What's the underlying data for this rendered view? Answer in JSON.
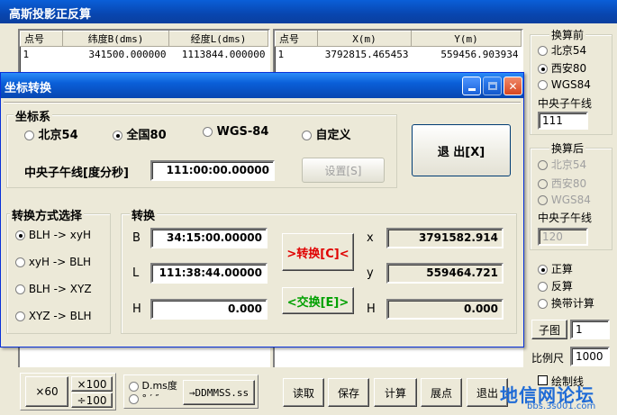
{
  "outer": {
    "title": "高斯投影正反算",
    "left_table": {
      "headers": [
        "点号",
        "纬度B(dms)",
        "经度L(dms)"
      ],
      "rows": [
        [
          "1",
          "341500.000000",
          "1113844.000000"
        ]
      ]
    },
    "right_table": {
      "headers": [
        "点号",
        "X(m)",
        "Y(m)"
      ],
      "rows": [
        [
          "1",
          "3792815.465453",
          "559456.903934"
        ]
      ]
    },
    "before": {
      "title": "换算前",
      "options": [
        "北京54",
        "西安80",
        "WGS84"
      ],
      "selected": 1,
      "cm_label": "中央子午线",
      "cm_value": "111"
    },
    "after": {
      "title": "换算后",
      "options": [
        "北京54",
        "西安80",
        "WGS84"
      ],
      "cm_label": "中央子午线",
      "cm_value": "120"
    },
    "modes": [
      "正算",
      "反算",
      "换带计算"
    ],
    "mode_selected": 0,
    "subgraph_button": "子图",
    "subgraph_value": "1",
    "scale_label": "比例尺",
    "scale_value": "1000",
    "draw_line_label": "绘制线",
    "bottom": {
      "x60": "×60",
      "x100": "×100",
      "div100": "÷100",
      "fmt_dms": "D.ms度",
      "fmt_sym": "°  ′  ″",
      "to_ddmmss": "→DDMMSS.ss",
      "read": "读取",
      "save": "保存",
      "calc": "计算",
      "plot": "展点",
      "exit": "退出"
    },
    "watermark": "地信网论坛",
    "watermark_url": "bbs.3s001.com"
  },
  "dialog": {
    "title": "坐标转换",
    "coord_sys": {
      "label": "坐标系",
      "options": [
        "北京54",
        "全国80",
        "WGS-84",
        "自定义"
      ],
      "selected": 1,
      "cm_label": "中央子午线[度分秒]",
      "cm_value": "111:00:00.00000",
      "set_button": "设置[S]"
    },
    "exit_button": "退 出[X]",
    "method": {
      "label": "转换方式选择",
      "options": [
        "BLH -> xyH",
        "xyH -> BLH",
        "BLH -> XYZ",
        "XYZ -> BLH"
      ],
      "selected": 0
    },
    "convert": {
      "label": "转换",
      "B_label": "B",
      "B_value": "34:15:00.00000",
      "L_label": "L",
      "L_value": "111:38:44.00000",
      "H_label": "H",
      "H_value": "0.000",
      "convert_button": ">转换[C]<",
      "swap_button": "<交换[E]>",
      "x_label": "x",
      "x_value": "3791582.914",
      "y_label": "y",
      "y_value": "559464.721",
      "h_label": "H",
      "h_value": "0.000"
    }
  },
  "colors": {
    "titlebar": "#0a5fd8",
    "convert_text": "#e00000",
    "swap_text": "#00a000"
  }
}
